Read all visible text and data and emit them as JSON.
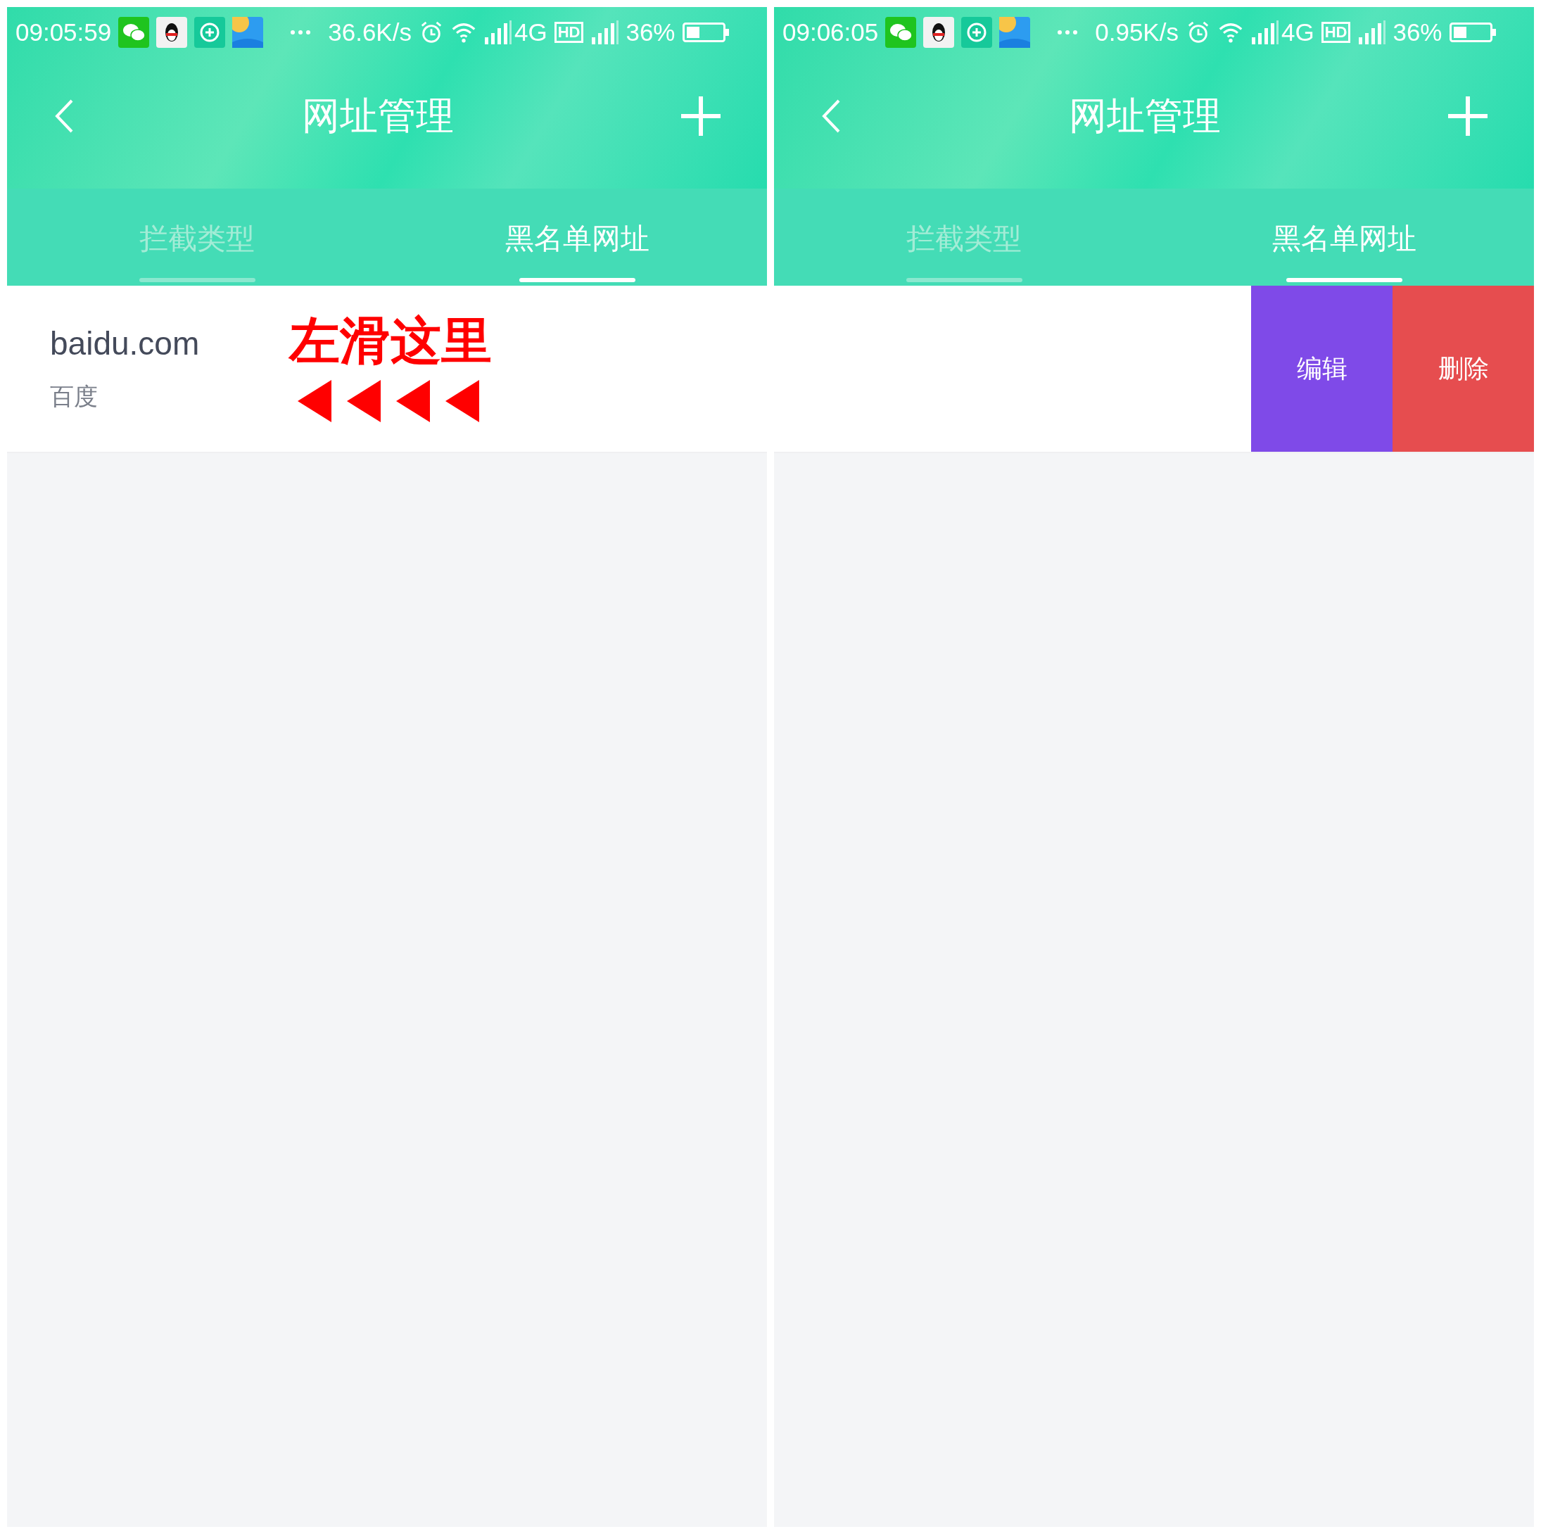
{
  "screens": [
    {
      "status_bar": {
        "time": "09:05:59",
        "speed": "36.6K/s",
        "network": "4G",
        "hd": "HD",
        "battery": "36%"
      },
      "nav": {
        "title": "网址管理"
      },
      "tabs": [
        {
          "label": "拦截类型",
          "selected": false
        },
        {
          "label": "黑名单网址",
          "selected": true
        }
      ],
      "rows": [
        {
          "swiped": false,
          "domain": "baidu.com",
          "name": "百度",
          "hint": "左滑这里"
        }
      ]
    },
    {
      "status_bar": {
        "time": "09:06:05",
        "speed": "0.95K/s",
        "network": "4G",
        "hd": "HD",
        "battery": "36%"
      },
      "nav": {
        "title": "网址管理"
      },
      "tabs": [
        {
          "label": "拦截类型",
          "selected": false
        },
        {
          "label": "黑名单网址",
          "selected": true
        }
      ],
      "rows": [
        {
          "swiped": true,
          "actions": [
            {
              "kind": "edit",
              "label": "编辑"
            },
            {
              "kind": "delete",
              "label": "删除"
            }
          ]
        }
      ]
    }
  ]
}
